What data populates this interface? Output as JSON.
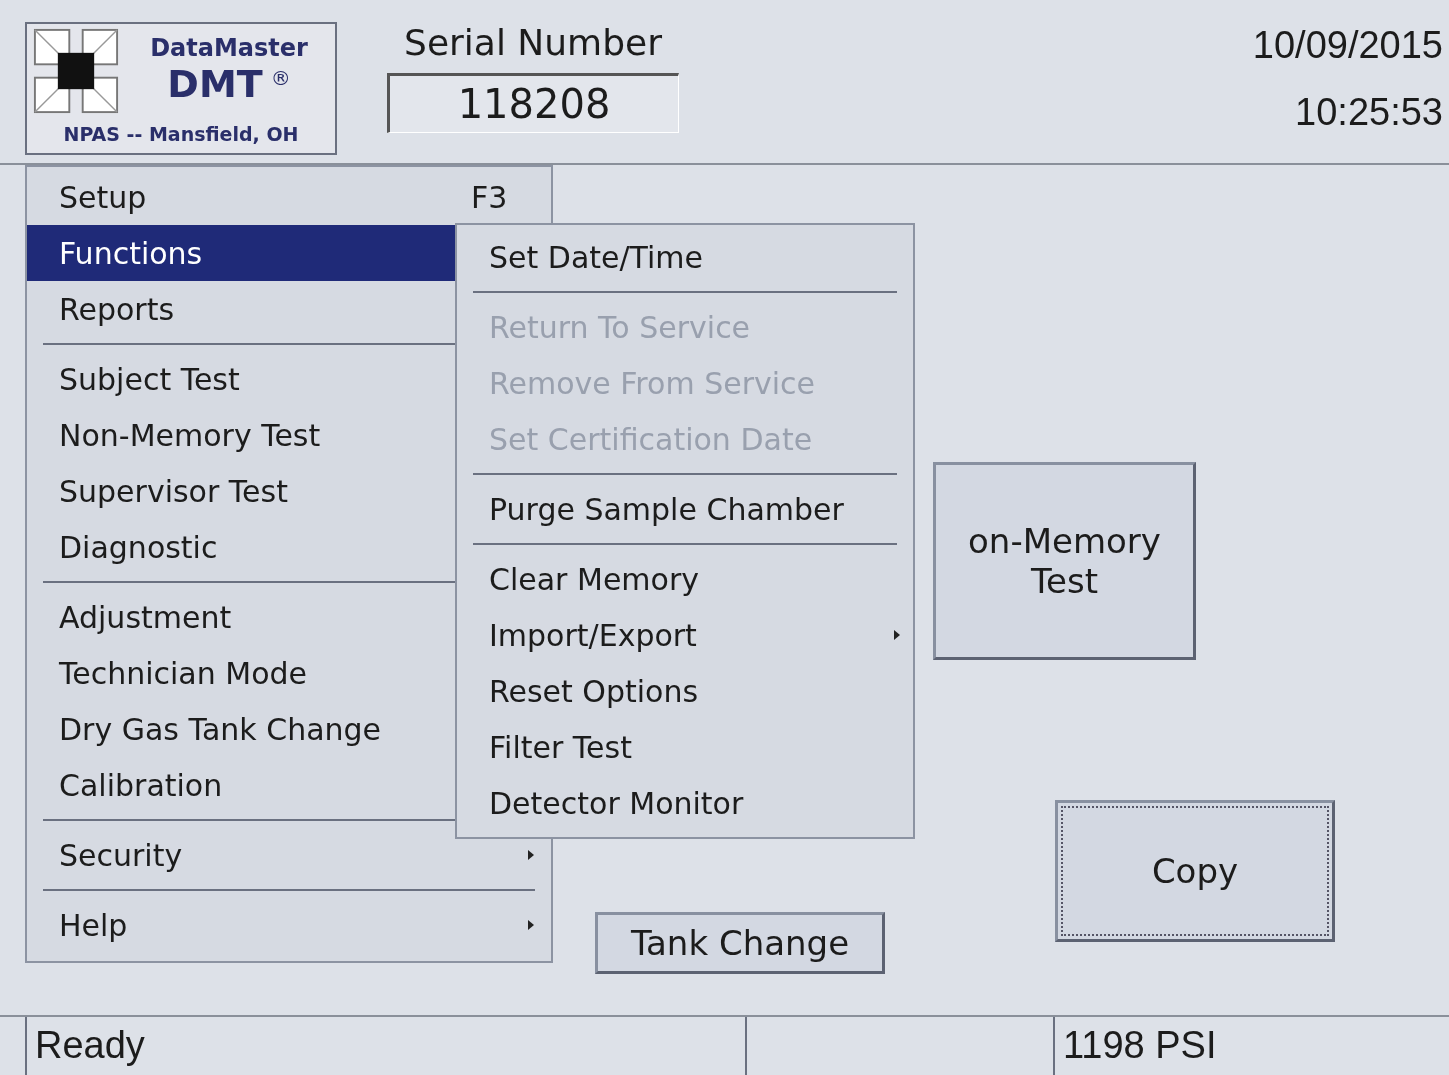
{
  "logo": {
    "brand": "DataMaster",
    "model": "DMT",
    "mark": "®",
    "location": "NPAS -- Mansfield, OH"
  },
  "serial": {
    "label": "Serial Number",
    "value": "118208"
  },
  "clock": {
    "date": "10/09/2015",
    "time": "10:25:53"
  },
  "background_buttons": {
    "non_memory": [
      "on-Memory",
      "Test"
    ],
    "tank": "Tank Change",
    "copy": "Copy"
  },
  "menu": {
    "items": [
      {
        "kind": "item",
        "label": "Setup",
        "shortcut": "F3",
        "selected": false
      },
      {
        "kind": "item",
        "label": "Functions",
        "selected": true
      },
      {
        "kind": "item",
        "label": "Reports",
        "selected": false
      },
      {
        "kind": "separator"
      },
      {
        "kind": "item",
        "label": "Subject Test",
        "selected": false
      },
      {
        "kind": "item",
        "label": "Non-Memory Test",
        "selected": false
      },
      {
        "kind": "item",
        "label": "Supervisor Test",
        "selected": false
      },
      {
        "kind": "item",
        "label": "Diagnostic",
        "selected": false
      },
      {
        "kind": "separator"
      },
      {
        "kind": "item",
        "label": "Adjustment",
        "selected": false
      },
      {
        "kind": "item",
        "label": "Technician Mode",
        "selected": false
      },
      {
        "kind": "item",
        "label": "Dry Gas Tank Change",
        "selected": false
      },
      {
        "kind": "item",
        "label": "Calibration",
        "selected": false
      },
      {
        "kind": "separator"
      },
      {
        "kind": "item",
        "label": "Security",
        "selected": false,
        "submenu": true
      },
      {
        "kind": "separator"
      },
      {
        "kind": "item",
        "label": "Help",
        "selected": false,
        "submenu": true
      }
    ]
  },
  "submenu": {
    "items": [
      {
        "kind": "item",
        "label": "Set Date/Time",
        "disabled": false
      },
      {
        "kind": "separator"
      },
      {
        "kind": "item",
        "label": "Return To Service",
        "disabled": true
      },
      {
        "kind": "item",
        "label": "Remove From Service",
        "disabled": true
      },
      {
        "kind": "item",
        "label": "Set Certification Date",
        "disabled": true
      },
      {
        "kind": "separator"
      },
      {
        "kind": "item",
        "label": "Purge Sample Chamber",
        "disabled": false
      },
      {
        "kind": "separator"
      },
      {
        "kind": "item",
        "label": "Clear Memory",
        "disabled": false
      },
      {
        "kind": "item",
        "label": "Import/Export",
        "disabled": false,
        "submenu": true
      },
      {
        "kind": "item",
        "label": "Reset Options",
        "disabled": false
      },
      {
        "kind": "item",
        "label": "Filter Test",
        "disabled": false
      },
      {
        "kind": "item",
        "label": "Detector Monitor",
        "disabled": false
      }
    ]
  },
  "status_bar": {
    "message": "Ready",
    "pressure": "1198 PSI"
  }
}
